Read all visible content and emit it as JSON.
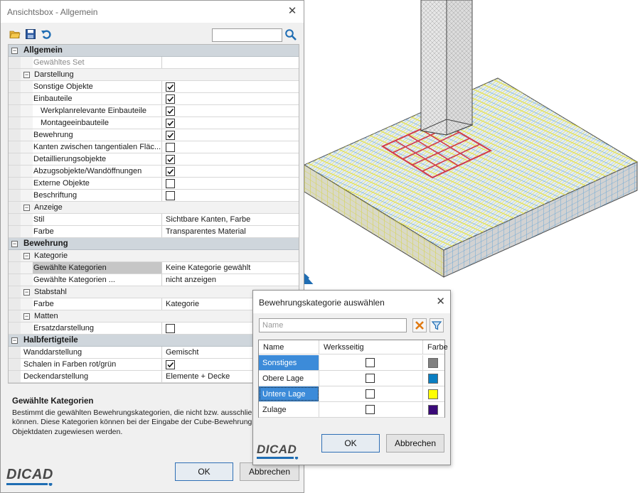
{
  "main_dialog": {
    "title": "Ansichtsbox - Allgemein",
    "close_glyph": "✕",
    "search": {
      "value": "",
      "placeholder": ""
    },
    "toolbar_icons": [
      "open-folder-icon",
      "save-icon",
      "undo-icon",
      "search-icon"
    ],
    "property_rows": [
      {
        "kind": "cat",
        "toggle": "⊟",
        "label": "Allgemein"
      },
      {
        "kind": "prop-disabled",
        "label": "Gewähltes Set",
        "value": ""
      },
      {
        "kind": "sub",
        "toggle": "⊟",
        "label": "Darstellung"
      },
      {
        "kind": "prop",
        "label": "Sonstige Objekte",
        "checked": true
      },
      {
        "kind": "prop",
        "label": "Einbauteile",
        "checked": true
      },
      {
        "kind": "prop",
        "indent": true,
        "label": "Werkplanrelevante Einbauteile",
        "checked": true
      },
      {
        "kind": "prop",
        "indent": true,
        "label": "Montageeinbauteile",
        "checked": true
      },
      {
        "kind": "prop",
        "label": "Bewehrung",
        "checked": true
      },
      {
        "kind": "prop",
        "label": "Kanten zwischen tangentialen Fläc...",
        "checked": false
      },
      {
        "kind": "prop",
        "label": "Detaillierungsobjekte",
        "checked": true
      },
      {
        "kind": "prop",
        "label": "Abzugsobjekte/Wandöffnungen",
        "checked": true
      },
      {
        "kind": "prop",
        "label": "Externe Objekte",
        "checked": false
      },
      {
        "kind": "prop",
        "label": "Beschriftung",
        "checked": false
      },
      {
        "kind": "sub",
        "toggle": "⊟",
        "label": "Anzeige"
      },
      {
        "kind": "prop",
        "label": "Stil",
        "value": "Sichtbare Kanten, Farbe"
      },
      {
        "kind": "prop",
        "label": "Farbe",
        "value": "Transparentes Material"
      },
      {
        "kind": "cat",
        "toggle": "⊟",
        "label": "Bewehrung"
      },
      {
        "kind": "sub",
        "toggle": "⊟",
        "label": "Kategorie"
      },
      {
        "kind": "prop",
        "selected": true,
        "label": "Gewählte Kategorien",
        "value": "Keine Kategorie gewählt"
      },
      {
        "kind": "prop",
        "label": "Gewählte Kategorien ...",
        "value": "nicht anzeigen"
      },
      {
        "kind": "sub",
        "toggle": "⊟",
        "label": "Stabstahl"
      },
      {
        "kind": "prop",
        "label": "Farbe",
        "value": "Kategorie"
      },
      {
        "kind": "sub",
        "toggle": "⊟",
        "label": "Matten"
      },
      {
        "kind": "prop",
        "label": "Ersatzdarstellung",
        "checked": false
      },
      {
        "kind": "cat",
        "toggle": "⊟",
        "label": "Halbfertigteile"
      },
      {
        "kind": "prop-top",
        "label": "Wanddarstellung",
        "value": "Gemischt"
      },
      {
        "kind": "prop-top",
        "label": "Schalen in Farben rot/grün",
        "checked": true
      },
      {
        "kind": "prop-top",
        "label": "Deckendarstellung",
        "value": "Elemente + Decke"
      }
    ],
    "description": {
      "title": "Gewählte Kategorien",
      "text": "Bestimmt die gewählten Bewehrungskategorien, die nicht bzw. ausschließlich angezeigt werden können. Diese Kategorien können bei der Eingabe der Cube-Bewehrung oder nachträglich in den Objektdaten zugewiesen werden."
    },
    "ok_label": "OK",
    "cancel_label": "Abbrechen",
    "logo_text": "DICAD"
  },
  "category_dialog": {
    "title": "Bewehrungskategorie auswählen",
    "close_glyph": "✕",
    "name_field": {
      "value": "",
      "placeholder": "Name"
    },
    "columns": [
      "Name",
      "Werksseitig",
      "Farbe"
    ],
    "rows": [
      {
        "name": "Sonstiges",
        "werksseitig": false,
        "color": "#808080",
        "selected": true
      },
      {
        "name": "Obere Lage",
        "werksseitig": false,
        "color": "#0a7ec2",
        "selected": false
      },
      {
        "name": "Untere Lage",
        "werksseitig": false,
        "color": "#ffff00",
        "selected": true,
        "focused": true
      },
      {
        "name": "Zulage",
        "werksseitig": false,
        "color": "#3a0a78",
        "selected": false
      }
    ],
    "ok_label": "OK",
    "cancel_label": "Abbrechen",
    "logo_text": "DICAD"
  },
  "colors": {
    "selection_blue": "#3c8bd9",
    "category_header": "#cfd6dc",
    "accent_arrow": "#1f6db3",
    "slab_mesh_blue": "#6fa8d8",
    "slab_mesh_yellow": "#e8e65a",
    "rebar_red": "#d23a4a"
  }
}
